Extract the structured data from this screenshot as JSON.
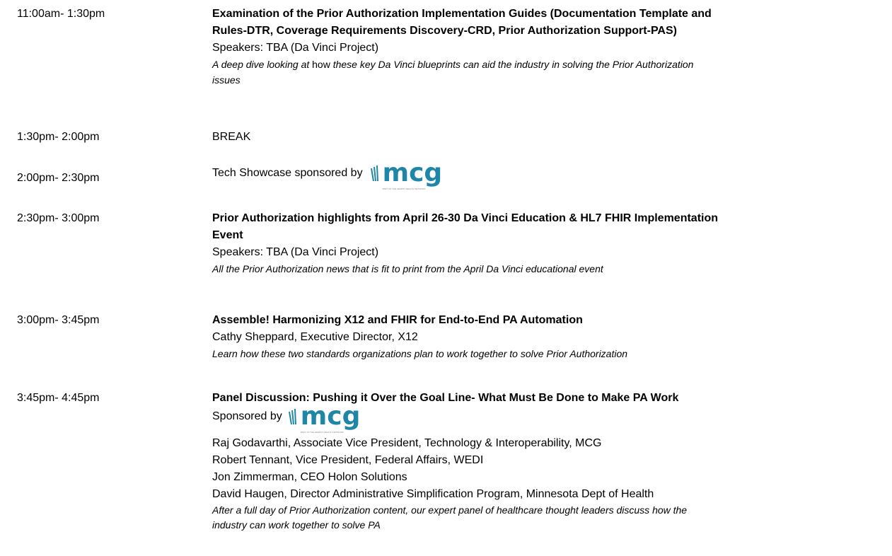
{
  "agenda": [
    {
      "time": "11:00am- 1:30pm",
      "title_lines": [
        "Examination of the Prior Authorization Implementation Guides (Documentation Template and",
        "Rules-DTR, Coverage Requirements Discovery-CRD, Prior Authorization Support-PAS)"
      ],
      "speakers": "Speakers: TBA (Da Vinci Project)",
      "desc_a": "A deep dive looking at ",
      "desc_b": "how ",
      "desc_c": "these key Da Vinci blueprints can aid the industry in solving the Prior Authorization",
      "desc_d": "issues"
    },
    {
      "time": "1:30pm- 2:00pm",
      "text": "BREAK"
    },
    {
      "time": "2:00pm- 2:30pm",
      "text": "Tech Showcase sponsored by",
      "logo_word": "mcg",
      "logo_tag": "PART OF THE HEARST HEALTH NETWORK"
    },
    {
      "time": "2:30pm- 3:00pm",
      "title_lines": [
        "Prior Authorization highlights from April 26-30 Da Vinci Education & HL7 FHIR Implementation",
        "Event"
      ],
      "speakers": "Speakers: TBA (Da Vinci Project)",
      "desc": "All the Prior Authorization news that is fit to print from the April Da Vinci educational event"
    },
    {
      "time": "3:00pm- 3:45pm",
      "title": "Assemble! Harmonizing X12 and FHIR for End-to-End PA Automation",
      "speakers": "Cathy Sheppard, Executive Director, X12",
      "desc": "Learn how these two standards organizations plan to work together to solve Prior Authorization"
    },
    {
      "time": "3:45pm- 4:45pm",
      "title": "Panel Discussion: Pushing it Over the Goal Line- What Must Be Done to Make PA Work",
      "sponsor_text": "Sponsored by",
      "logo_word": "mcg",
      "logo_tag": "PART OF THE HEARST HEALTH NETWORK",
      "panelists": [
        "Raj Godavarthi, Associate Vice President, Technology & Interoperability, MCG",
        "Robert Tennant, Vice President, Federal Affairs, WEDI",
        "Jon Zimmerman, CEO Holon Solutions",
        "David Haugen, Director Administrative Simplification Program, Minnesota Dept of Health"
      ],
      "desc_lines": [
        "After a full day of Prior Authorization content, our expert panel of healthcare thought leaders discuss how the",
        "industry can work together to solve PA"
      ]
    }
  ],
  "colors": {
    "logo": "#1f86a8",
    "text": "#000000"
  },
  "icons": {
    "logo": "mcg-logo-icon"
  }
}
